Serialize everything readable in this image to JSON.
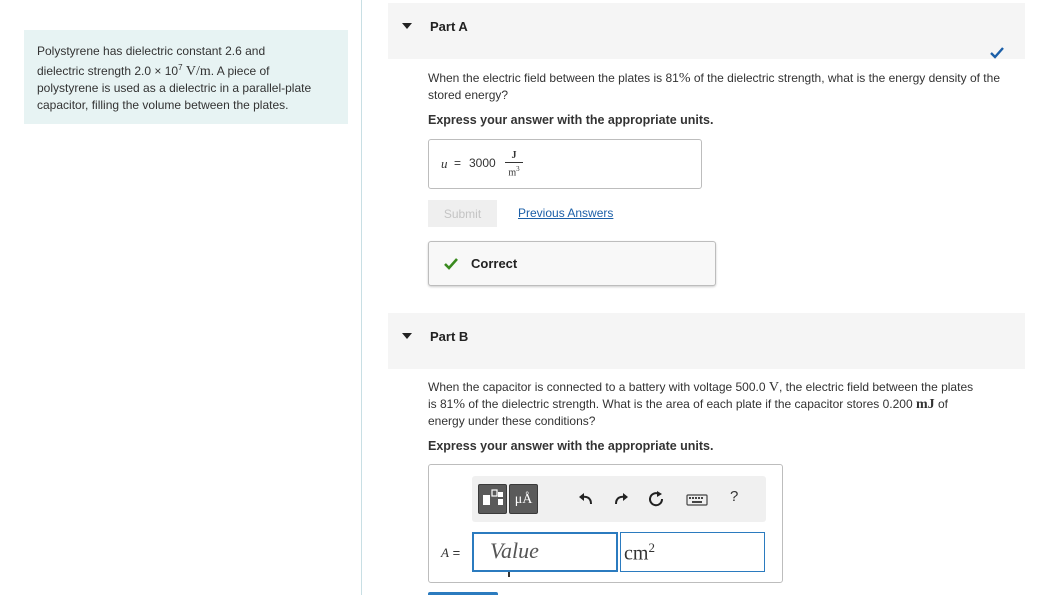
{
  "problem": {
    "line1": "Polystyrene has dielectric constant 2.6 and",
    "line2_pre": "dielectric strength 2.0 × 10",
    "line2_exp": "7",
    "line2_unit": "V/m",
    "line2_post": ". A piece of",
    "line3": "polystyrene is used as a dielectric in a parallel-plate",
    "line4": "capacitor, filling the volume between the plates."
  },
  "partA": {
    "title": "Part A",
    "question_pre": "When the electric field between the plates is 81",
    "question_pct": "%",
    "question_post": " of the dielectric strength, what is the energy density of the stored energy?",
    "hint": "Express your answer with the appropriate units.",
    "answer_var": "u",
    "answer_eq": "=",
    "answer_value": "3000",
    "unit_num": "J",
    "unit_den": "m",
    "unit_den_exp": "3",
    "submit": "Submit",
    "previous_answers": "Previous Answers",
    "feedback": "Correct"
  },
  "partB": {
    "title": "Part B",
    "question_l1_pre": "When the capacitor is connected to a battery with voltage 500.0 ",
    "question_l1_unit": "V",
    "question_l1_post": ", the electric field between the plates",
    "question_l2_pre": "is 81",
    "question_l2_pct": "%",
    "question_l2_mid": " of the dielectric strength. What is the area of each plate if the capacitor stores 0.200 ",
    "question_l2_unit": "mJ",
    "question_l2_post": " of",
    "question_l3": "energy under these conditions?",
    "hint": "Express your answer with the appropriate units.",
    "toolbar": {
      "units_label": "μÅ",
      "help": "?"
    },
    "answer_var": "A",
    "answer_eq": "=",
    "value_placeholder": "Value",
    "unit_base": "cm",
    "unit_exp": "2"
  },
  "colors": {
    "accent": "#2b7bbf",
    "correct_green": "#3a8a1f",
    "panel_bg": "#e7f3f3",
    "link": "#1b5fa8"
  }
}
